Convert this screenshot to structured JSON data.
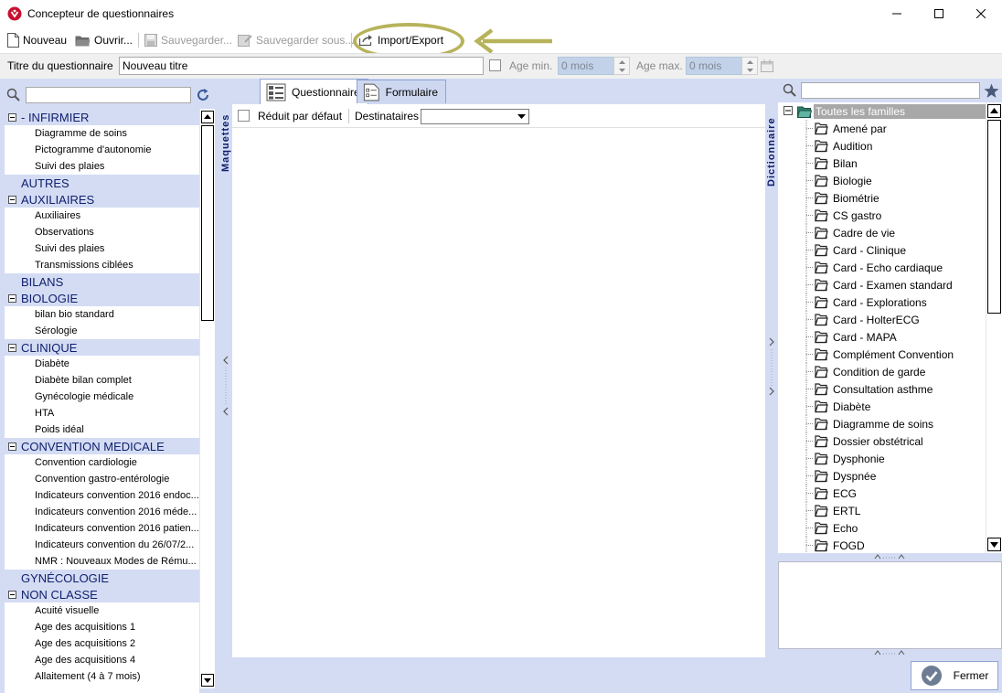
{
  "window": {
    "title": "Concepteur de questionnaires",
    "minimize": "—",
    "maximize": "☐",
    "close": "✕"
  },
  "toolbar": {
    "new_label": "Nouveau",
    "open_label": "Ouvrir...",
    "save_label": "Sauvegarder...",
    "save_under_label": "Sauvegarder sous...",
    "import_export_label": "Import/Export"
  },
  "form": {
    "title_label": "Titre du questionnaire",
    "title_value": "Nouveau titre",
    "age_min_label": "Age min.",
    "age_min_value": "0 mois",
    "age_max_label": "Age max.",
    "age_max_value": "0 mois"
  },
  "left_panel": {
    "vertical_label": "Maquettes",
    "groups": [
      {
        "label": "- INFIRMIER",
        "collapsible": true,
        "items": [
          "Diagramme de soins",
          "Pictogramme d'autonomie",
          "Suivi des plaies"
        ]
      },
      {
        "label": "AUTRES",
        "collapsible": false,
        "items": []
      },
      {
        "label": "AUXILIAIRES",
        "collapsible": true,
        "items": [
          "Auxiliaires",
          "Observations",
          "Suivi des plaies",
          "Transmissions ciblées"
        ]
      },
      {
        "label": "BILANS",
        "collapsible": false,
        "items": []
      },
      {
        "label": "BIOLOGIE",
        "collapsible": true,
        "items": [
          "bilan bio standard",
          "Sérologie"
        ]
      },
      {
        "label": "CLINIQUE",
        "collapsible": true,
        "items": [
          "Diabète",
          "Diabète bilan complet",
          "Gynécologie médicale",
          "HTA",
          "Poids idéal"
        ]
      },
      {
        "label": "CONVENTION MEDICALE",
        "collapsible": true,
        "items": [
          "Convention cardiologie",
          "Convention gastro-entérologie",
          "Indicateurs convention 2016 endoc...",
          "Indicateurs convention 2016 méde...",
          "Indicateurs convention 2016 patien...",
          "Indicateurs convention du 26/07/2...",
          "NMR : Nouveaux Modes de Rému..."
        ]
      },
      {
        "label": "GYNÉCOLOGIE",
        "collapsible": false,
        "items": []
      },
      {
        "label": "NON CLASSE",
        "collapsible": true,
        "items": [
          "Acuité visuelle",
          "Age des acquisitions 1",
          "Age des acquisitions 2",
          "Age des acquisitions 4",
          "Allaitement (4 à 7 mois)"
        ]
      }
    ]
  },
  "tabs": [
    {
      "label": "Questionnaire",
      "active": true
    },
    {
      "label": "Formulaire",
      "active": false
    }
  ],
  "center": {
    "reduced_label": "Réduit par défaut",
    "recipients_label": "Destinataires",
    "recipients_value": ""
  },
  "right_panel": {
    "vertical_label": "Dictionnaire",
    "root_label": "Toutes les familles",
    "items": [
      "Amené par",
      "Audition",
      "Bilan",
      "Biologie",
      "Biométrie",
      "CS gastro",
      "Cadre de vie",
      "Card - Clinique",
      "Card - Echo cardiaque",
      "Card - Examen standard",
      "Card - Explorations",
      "Card - HolterECG",
      "Card - MAPA",
      "Complément Convention",
      "Condition de garde",
      "Consultation asthme",
      "Diabète",
      "Diagramme de soins",
      "Dossier obstétrical",
      "Dysphonie",
      "Dyspnée",
      "ECG",
      "ERTL",
      "Echo",
      "FOGD"
    ]
  },
  "footer": {
    "close_label": "Fermer"
  },
  "colors": {
    "panel_bg": "#d4dcf4",
    "group_text": "#10206c",
    "highlight": "#b7b35a",
    "selected_row": "#a8a8a8"
  }
}
